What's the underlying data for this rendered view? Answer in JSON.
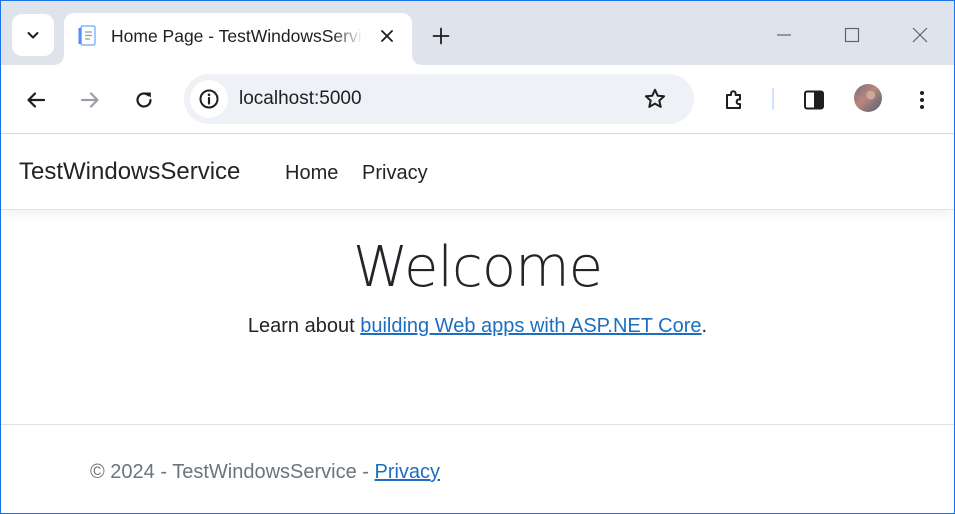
{
  "browser": {
    "tab": {
      "title": "Home Page - TestWindowsService"
    },
    "address_bar": {
      "url": "localhost:5000"
    },
    "icons": {
      "tab_search": "chevron-down-icon",
      "favicon": "page-icon",
      "tab_close": "close-icon",
      "new_tab": "plus-icon",
      "minimize": "minimize-icon",
      "maximize": "maximize-icon",
      "close_window": "close-icon",
      "back": "arrow-left-icon",
      "forward": "arrow-right-icon",
      "reload": "reload-icon",
      "site_info": "info-icon",
      "bookmark": "star-icon",
      "extensions": "puzzle-icon",
      "side_panel": "side-panel-icon",
      "profile": "avatar",
      "menu": "kebab-menu-icon"
    },
    "colors": {
      "tabstrip": "#dfe3eb",
      "omnibox": "#eef1f6",
      "window_border": "#1a73e8"
    }
  },
  "site": {
    "navbar": {
      "brand": "TestWindowsService",
      "links": [
        {
          "label": "Home"
        },
        {
          "label": "Privacy"
        }
      ]
    },
    "main": {
      "heading": "Welcome",
      "text_before": "Learn about ",
      "link_text": "building Web apps with ASP.NET Core",
      "text_after": "."
    },
    "footer": {
      "text": "© 2024 - TestWindowsService - ",
      "link_text": "Privacy"
    },
    "colors": {
      "link": "#1b6ec2",
      "text": "#212529",
      "muted": "#6c757d"
    }
  }
}
